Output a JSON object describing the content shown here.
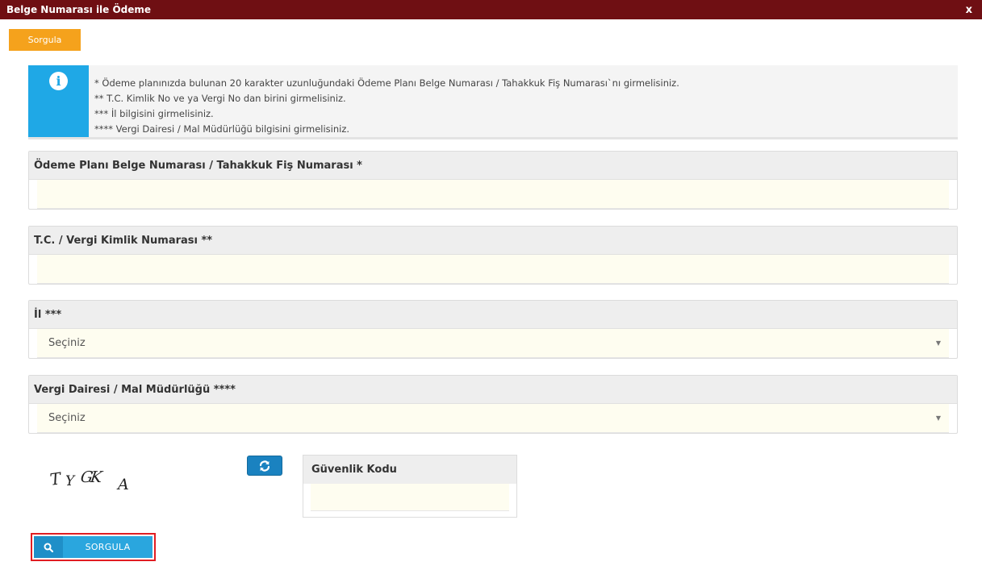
{
  "window": {
    "title": "Belge Numarası ile Ödeme",
    "close_label": "x"
  },
  "tab": {
    "label": "Sorgula"
  },
  "info": {
    "icon": "info-icon",
    "lines": [
      "* Ödeme planınızda bulunan 20 karakter uzunluğundaki Ödeme Planı Belge Numarası / Tahakkuk Fiş Numarası`nı girmelisiniz.",
      "** T.C. Kimlik No ve ya Vergi No dan birini girmelisiniz.",
      "*** İl bilgisini girmelisiniz.",
      "**** Vergi Dairesi / Mal Müdürlüğü bilgisini girmelisiniz."
    ]
  },
  "fields": {
    "belge_no": {
      "label": "Ödeme Planı Belge Numarası / Tahakkuk Fiş Numarası *",
      "value": ""
    },
    "tc_vergi": {
      "label": "T.C. / Vergi Kimlik Numarası **",
      "value": ""
    },
    "il": {
      "label": "İl ***",
      "selected": "Seçiniz"
    },
    "vergi_dairesi": {
      "label": "Vergi Dairesi / Mal Müdürlüğü ****",
      "selected": "Seçiniz"
    }
  },
  "captcha": {
    "text": "TYGKA",
    "chars": [
      "T",
      "Y",
      "GK",
      "A"
    ],
    "refresh_icon": "refresh-icon",
    "field_label": "Güvenlik Kodu",
    "value": ""
  },
  "submit": {
    "icon": "search-icon",
    "label": "SORGULA"
  },
  "colors": {
    "titlebar": "#6f0f13",
    "tab": "#f5a21c",
    "info_accent": "#1fa8e6",
    "button": "#2aa6de",
    "highlight_border": "#e11d22"
  }
}
